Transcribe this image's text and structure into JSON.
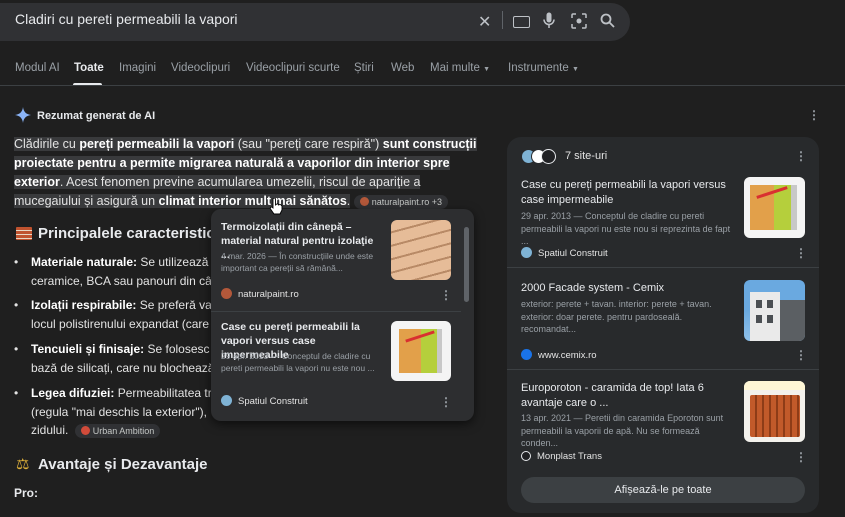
{
  "search": {
    "query": "Cladiri cu pereti permeabili la vapori"
  },
  "tabs": [
    "Modul AI",
    "Toate",
    "Imagini",
    "Videoclipuri",
    "Videoclipuri scurte",
    "Știri",
    "Web",
    "Mai multe",
    "Instrumente"
  ],
  "ai_overview": {
    "title": "Rezumat generat de AI",
    "intro": {
      "t1": "Clădirile cu ",
      "b1": "pereți permeabili la vapori",
      "t2": " (sau \"pereți care respiră\") ",
      "b2": "sunt construcții proiectate pentru a permite migrarea naturală a vaporilor din interior spre exterior",
      "t3": ". Acest fenomen previne acumularea umezelii, riscul de apariție a mucegaiului și asigură un ",
      "b3": "climat interior mult mai sănătos",
      "t4": "."
    },
    "intro_chip": "naturalpaint.ro +3",
    "section1_title": "Principalele caracteristici",
    "bullets": [
      {
        "label": "Materiale naturale:",
        "lines": [
          "Se utilizează",
          "ceramice, BCA sau panouri din câ"
        ]
      },
      {
        "label": "Izolații respirabile:",
        "lines": [
          "Se preferă vat",
          "locul polistirenului expandat (care"
        ]
      },
      {
        "label": "Tencuieli și finisaje:",
        "lines": [
          "Se folosesc t",
          "bază de silicați, care nu blochează"
        ]
      },
      {
        "label": "Legea difuziei:",
        "lines": [
          "Permeabilitatea tr",
          "(regula \"mai deschis la exterior\"),",
          "zidului."
        ]
      }
    ],
    "bullet4_chip": "Urban Ambition",
    "section2_title": "Avantaje și Dezavantaje",
    "pro_label": "Pro:"
  },
  "popup": {
    "items": [
      {
        "title": "Termoizolații din cânepă – material natural pentru izolaţie ...",
        "snippet": "4 mar. 2026 — În construcțiile unde este important ca pereții să rămână...",
        "source": "naturalpaint.ro"
      },
      {
        "title": "Case cu pereți permeabili la vapori versus case impermeabile",
        "snippet": "29 apr. 2013 — Conceptul de cladire cu pereti permeabili la vapori nu este nou ...",
        "source": "Spatiul Construit"
      }
    ]
  },
  "sites_panel": {
    "count_label": "7 site-uri",
    "items": [
      {
        "title": "Case cu pereți permeabili la vapori versus case impermeabile",
        "snippet": "29 apr. 2013 — Conceptul de cladire cu pereti permeabili la vapori nu este nou si reprezinta de fapt ...",
        "source": "Spatiul Construit"
      },
      {
        "title": "2000 Facade system - Cemix",
        "snippet": "exterior: perete + tavan. interior: perete + tavan. exterior: doar perete. pentru pardoseală. recomandat...",
        "source": "www.cemix.ro"
      },
      {
        "title": "Europoroton - caramida de top! Iata 6 avantaje care o ...",
        "snippet": "13 apr. 2021 — Peretii din caramida Eporoton sunt permeabili la vaporii de apă. Nu se formează conden...",
        "source": "Monplast Trans"
      }
    ],
    "show_all": "Afișează-le pe toate"
  },
  "colors": {
    "background": "#1f1f1f",
    "panel": "#282a2c",
    "accent_sparkle": "#8ab4f8"
  }
}
